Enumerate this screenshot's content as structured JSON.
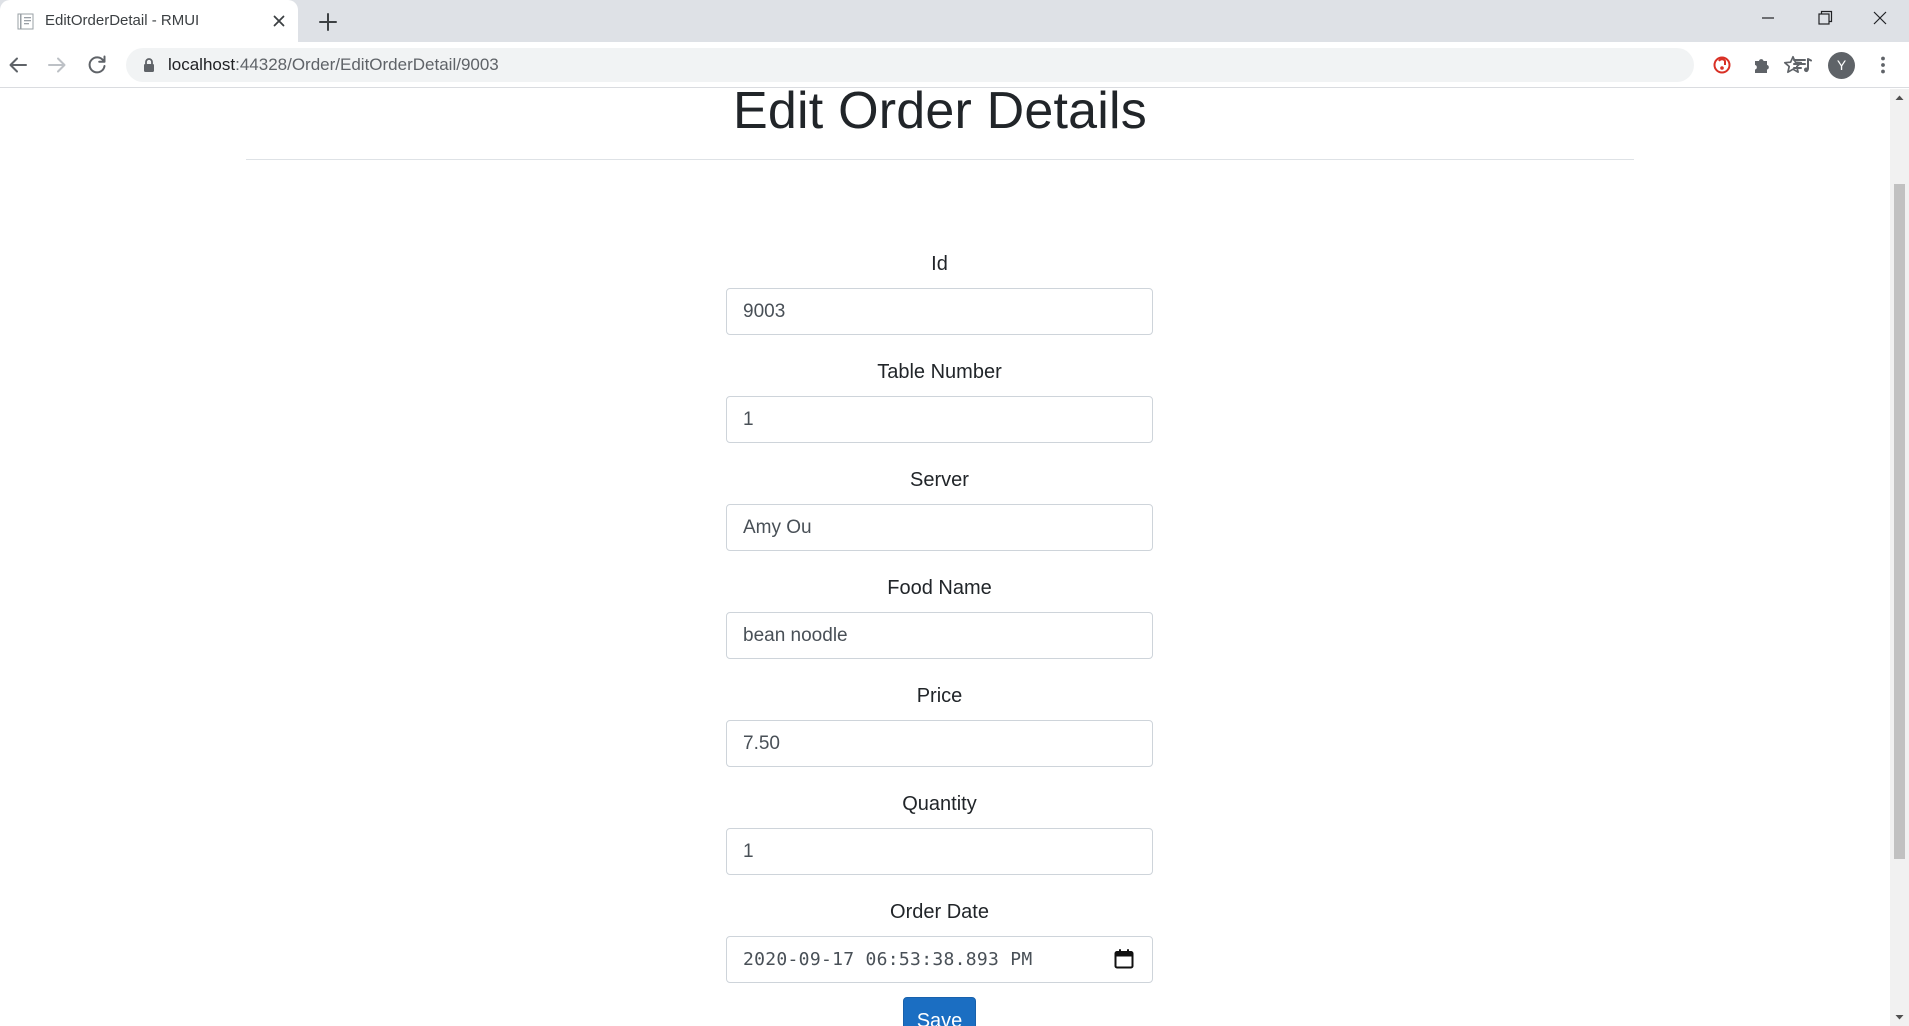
{
  "browser": {
    "tab_title": "EditOrderDetail - RMUI",
    "url_host": "localhost",
    "url_rest": ":44328/Order/EditOrderDetail/9003",
    "profile_initial": "Y"
  },
  "page": {
    "title": "Edit Order Details",
    "fields": [
      {
        "label": "Id",
        "value": "9003"
      },
      {
        "label": "Table Number",
        "value": "1"
      },
      {
        "label": "Server",
        "value": "Amy Ou"
      },
      {
        "label": "Food Name",
        "value": "bean noodle"
      },
      {
        "label": "Price",
        "value": "7.50"
      },
      {
        "label": "Quantity",
        "value": "1"
      },
      {
        "label": "Order Date",
        "value": "2020-09-17 06:53:38.893 PM"
      }
    ],
    "save_label": "Save"
  },
  "colors": {
    "primary_button": "#1b6ec2",
    "input_border": "#ced4da",
    "tabstrip": "#dee1e6"
  },
  "icons": [
    "page-favicon-icon",
    "close-icon",
    "plus-icon",
    "minimize-icon",
    "restore-icon",
    "window-close-icon",
    "back-arrow-icon",
    "forward-arrow-icon",
    "reload-icon",
    "lock-icon",
    "star-icon",
    "extension-icon",
    "puzzle-icon",
    "media-control-icon",
    "more-vert-icon",
    "calendar-icon"
  ]
}
